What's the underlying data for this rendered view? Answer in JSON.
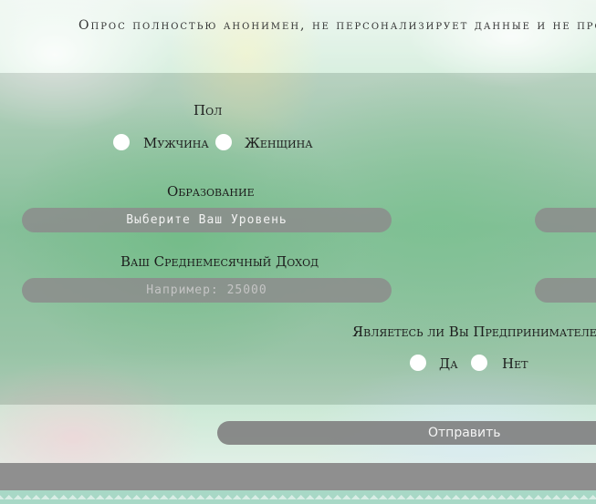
{
  "notice": "Опрос полностью анонимен, не персонализирует данные и не про",
  "gender": {
    "label": "Пол",
    "options": [
      "Мужчина",
      "Женщина"
    ]
  },
  "education": {
    "label": "Образование",
    "selected": "Выберите Ваш Уровень"
  },
  "income": {
    "label": "Ваш Среднемесячный Доход",
    "placeholder": "Например: 25000",
    "value": ""
  },
  "entrepreneur": {
    "label": "Являетесь ли Вы Предпринимателем?",
    "options": [
      "Да",
      "Нет"
    ]
  },
  "submit_label": "Отправить",
  "colors": {
    "field": "#8c8c8c",
    "footer": "#8f8f8f",
    "pattern": "#a8d8c6"
  }
}
